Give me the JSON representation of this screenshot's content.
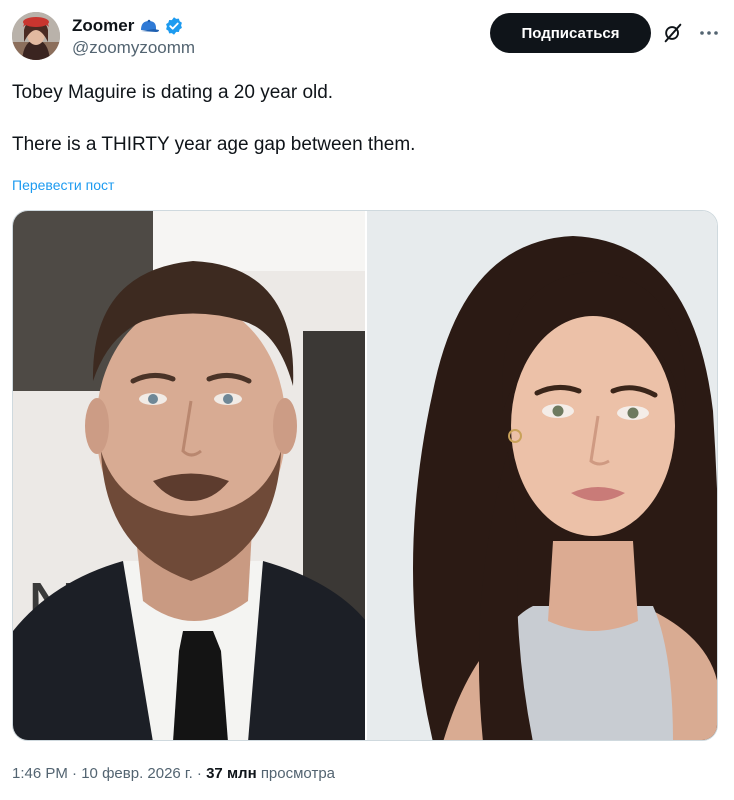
{
  "author": {
    "name": "Zoomer",
    "handle": "@zoomyzoomm",
    "badge_color": "#1d9bf0"
  },
  "follow_button": {
    "label": "Подписаться"
  },
  "tweet": {
    "line1": "Tobey Maguire is dating a 20 year old.",
    "line2": "There is a THIRTY year age gap between them.",
    "translate_link": "Перевести пост"
  },
  "media": {
    "left_photo": "man-portrait",
    "right_photo": "woman-portrait",
    "backdrop_letter": "N"
  },
  "meta": {
    "time": "1:46 PM",
    "separator": "·",
    "date": "10 февр. 2026 г.",
    "views_count": "37 млн",
    "views_label": "просмотра"
  },
  "colors": {
    "text": "#0f1419",
    "secondary": "#536471",
    "link": "#1d9bf0",
    "button_bg": "#0f1419"
  }
}
